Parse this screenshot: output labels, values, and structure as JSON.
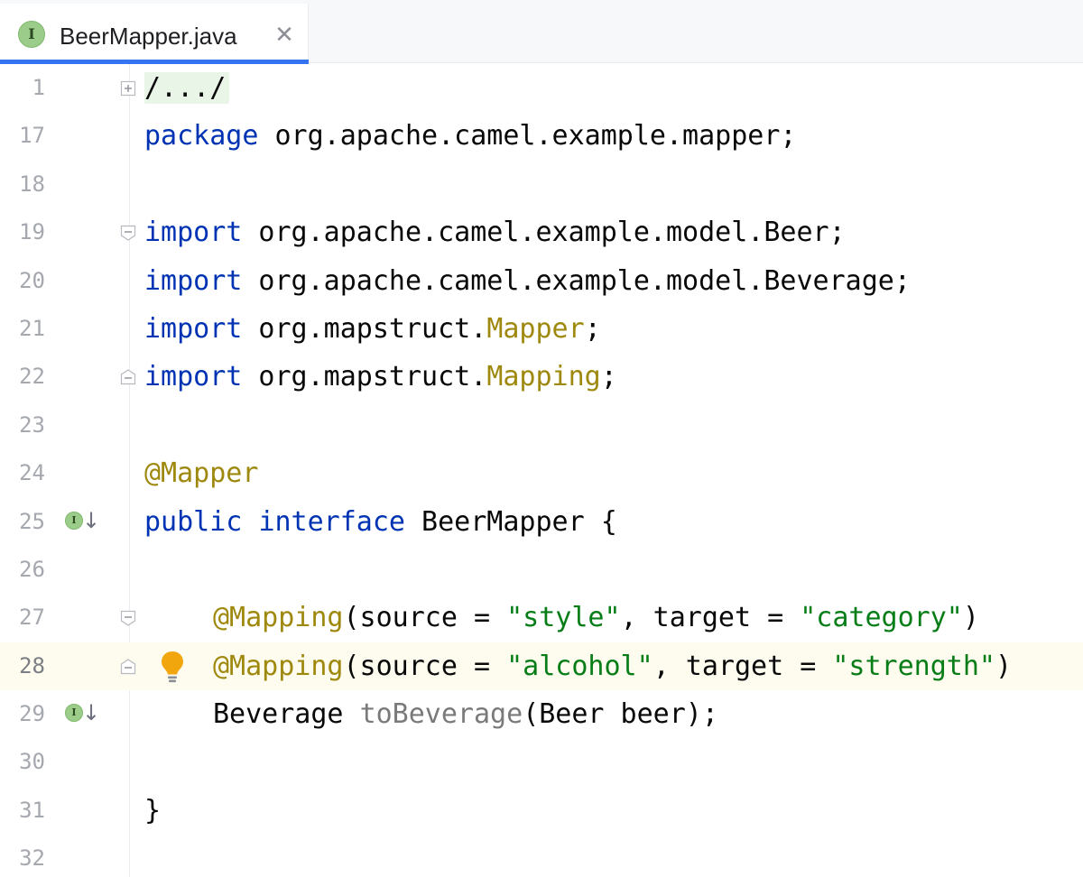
{
  "tab": {
    "icon_letter": "I",
    "title": "BeerMapper.java",
    "close_glyph": "✕"
  },
  "editor": {
    "lines": [
      {
        "number": "1",
        "tokens": [
          {
            "t": "/.../",
            "c": "folded"
          }
        ]
      },
      {
        "number": "17",
        "tokens": [
          {
            "t": "package",
            "c": "kw"
          },
          {
            "t": " org.apache.camel.example.mapper;",
            "c": "plain"
          }
        ]
      },
      {
        "number": "18",
        "tokens": []
      },
      {
        "number": "19",
        "tokens": [
          {
            "t": "import",
            "c": "kw"
          },
          {
            "t": " org.apache.camel.example.model.Beer;",
            "c": "plain"
          }
        ]
      },
      {
        "number": "20",
        "tokens": [
          {
            "t": "import",
            "c": "kw"
          },
          {
            "t": " org.apache.camel.example.model.Beverage;",
            "c": "plain"
          }
        ]
      },
      {
        "number": "21",
        "tokens": [
          {
            "t": "import",
            "c": "kw"
          },
          {
            "t": " org.mapstruct.",
            "c": "plain"
          },
          {
            "t": "Mapper",
            "c": "ann"
          },
          {
            "t": ";",
            "c": "plain"
          }
        ]
      },
      {
        "number": "22",
        "tokens": [
          {
            "t": "import",
            "c": "kw"
          },
          {
            "t": " org.mapstruct.",
            "c": "plain"
          },
          {
            "t": "Mapping",
            "c": "ann"
          },
          {
            "t": ";",
            "c": "plain"
          }
        ]
      },
      {
        "number": "23",
        "tokens": []
      },
      {
        "number": "24",
        "tokens": [
          {
            "t": "@Mapper",
            "c": "ann"
          }
        ]
      },
      {
        "number": "25",
        "tokens": [
          {
            "t": "public",
            "c": "kw"
          },
          {
            "t": " ",
            "c": "plain"
          },
          {
            "t": "interface",
            "c": "kw"
          },
          {
            "t": " BeerMapper {",
            "c": "plain"
          }
        ]
      },
      {
        "number": "26",
        "tokens": []
      },
      {
        "number": "27",
        "tokens": [
          {
            "t": "@Mapping",
            "c": "ann"
          },
          {
            "t": "(source = ",
            "c": "plain"
          },
          {
            "t": "\"style\"",
            "c": "str"
          },
          {
            "t": ", target = ",
            "c": "plain"
          },
          {
            "t": "\"category\"",
            "c": "str"
          },
          {
            "t": ")",
            "c": "plain"
          }
        ]
      },
      {
        "number": "28",
        "tokens": [
          {
            "t": "@Mapping",
            "c": "ann"
          },
          {
            "t": "(source = ",
            "c": "plain"
          },
          {
            "t": "\"alcohol\"",
            "c": "str"
          },
          {
            "t": ", target = ",
            "c": "plain"
          },
          {
            "t": "\"strength\"",
            "c": "str"
          },
          {
            "t": ")",
            "c": "plain"
          }
        ]
      },
      {
        "number": "29",
        "tokens": [
          {
            "t": "Beverage ",
            "c": "plain"
          },
          {
            "t": "toBeverage",
            "c": "method"
          },
          {
            "t": "(Beer beer);",
            "c": "plain"
          }
        ]
      },
      {
        "number": "30",
        "tokens": []
      },
      {
        "number": "31",
        "tokens": [
          {
            "t": "}",
            "c": "plain"
          }
        ]
      },
      {
        "number": "32",
        "tokens": []
      }
    ]
  },
  "gutter": {
    "impl_marker_letter": "I",
    "impl_marker_arrow": "↓"
  },
  "colors": {
    "keyword": "#0033b3",
    "annotation": "#9e880d",
    "string": "#067d17",
    "text": "#080808",
    "unused_method": "#7a7a7a",
    "current_line": "#fdfcee",
    "tab_underline": "#3574f0"
  },
  "icons": {
    "tab_icon": "interface-icon",
    "close": "close-icon",
    "intention": "lightbulb-icon",
    "gutter_marker": "implemented-interface-icon",
    "fold": "fold-icon"
  }
}
